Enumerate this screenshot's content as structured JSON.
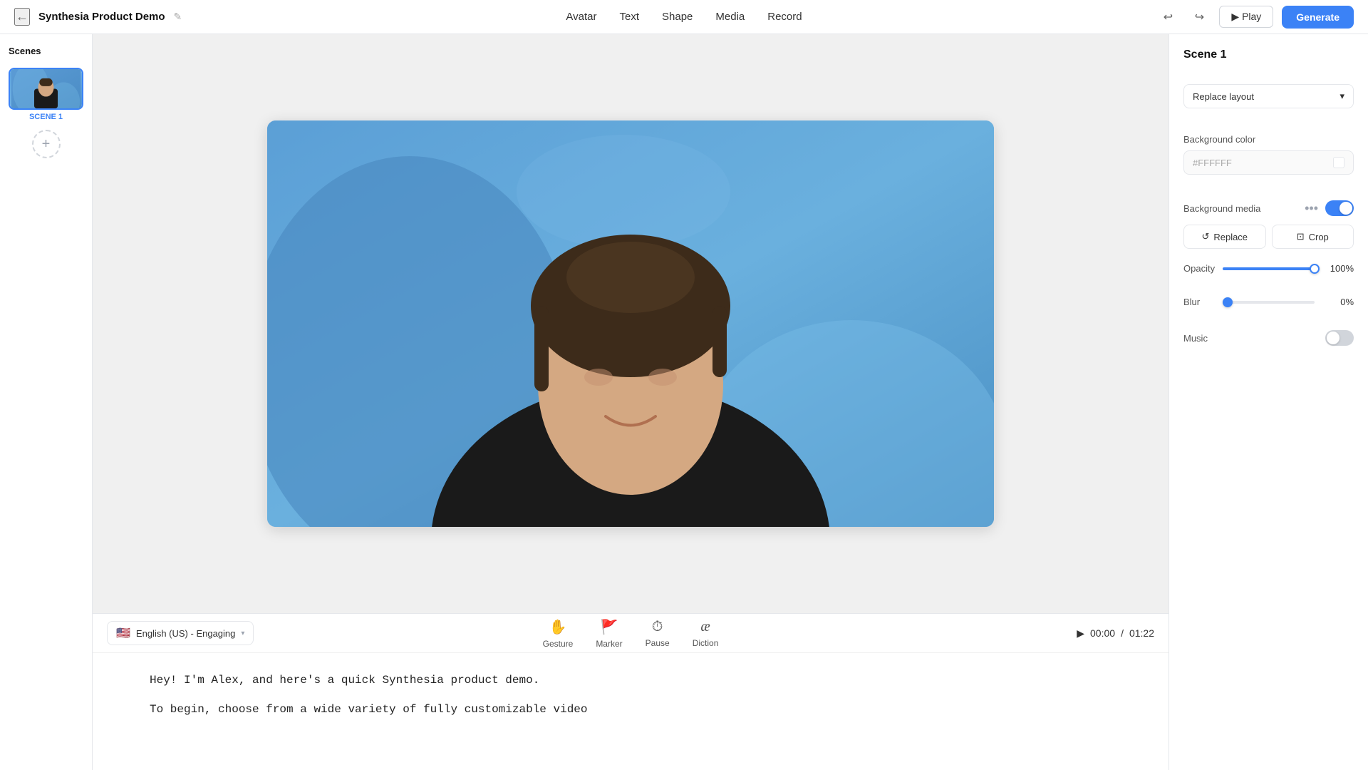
{
  "header": {
    "back_icon": "←",
    "project_title": "Synthesia Product Demo",
    "project_icon": "✎",
    "nav_items": [
      "Avatar",
      "Text",
      "Shape",
      "Media",
      "Record"
    ],
    "play_label": "▶ Play",
    "generate_label": "Generate"
  },
  "scenes": {
    "label": "Scenes",
    "items": [
      {
        "id": 1,
        "label": "SCENE 1"
      }
    ],
    "add_label": "+"
  },
  "script_toolbar": {
    "language": "English (US) - Engaging",
    "gesture_label": "Gesture",
    "marker_label": "Marker",
    "pause_label": "Pause",
    "diction_label": "Diction",
    "time_current": "00:00",
    "time_total": "01:22"
  },
  "script_content": {
    "line1": "Hey! I'm Alex, and here's a quick Synthesia product demo.",
    "line2": "To begin, choose from a wide variety of fully customizable video"
  },
  "right_panel": {
    "scene_label": "Scene 1",
    "replace_layout_label": "Replace layout",
    "background_color_label": "Background color",
    "background_color_value": "#FFFFFF",
    "background_media_label": "Background media",
    "replace_label": "Replace",
    "crop_label": "Crop",
    "opacity_label": "Opacity",
    "opacity_value": "100",
    "opacity_unit": "%",
    "blur_label": "Blur",
    "blur_value": "0",
    "blur_unit": "%",
    "music_label": "Music"
  },
  "icons": {
    "gesture": "✋",
    "marker": "⚑",
    "pause": "⏱",
    "diction": "æ",
    "play": "▶",
    "replace": "↺",
    "crop": "⊡",
    "more": "•••"
  }
}
